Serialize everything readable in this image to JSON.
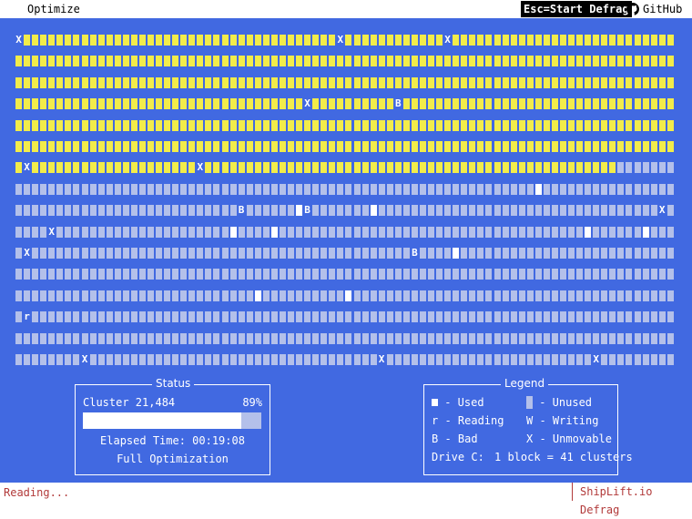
{
  "menu": {
    "optimize": "Optimize"
  },
  "toolbar": {
    "esc_hint": "Esc=Start Defrag",
    "github_label": "GitHub"
  },
  "colors": {
    "background": "#4169e1",
    "used": "#f2ec4a",
    "bar_text": "#b23a3a"
  },
  "disk_map": {
    "rows": [
      "X                                      X            X                                                 ",
      "                                                                                                      ",
      "                                                                                                      ",
      "                                   X          B                                                       ",
      "                                                                                                  X   ",
      "                                                                                                      ",
      " X                    X                                                                     ..........",
      "...............................................................w......................................",
      "...........................B......wB.......w..................................X.........................w",
      "....X.....................w....w.....................................w......w...........................",
      ".X..............................................B....w.................................................",
      "..................................................................................r...................",
      ".............................w..........w..............................................................",
      ".r................................................................................X.............w.....",
      ".............................................................................................w.X.....",
      "........X...................................X.........................X..............................."
    ]
  },
  "status": {
    "title": "Status",
    "cluster": "Cluster 21,484",
    "percent": "89%",
    "progress": 0.89,
    "elapsed": "Elapsed Time: 00:19:08",
    "mode": "Full Optimization"
  },
  "legend": {
    "title": "Legend",
    "used": "- Used",
    "unused": "- Unused",
    "reading": "r - Reading",
    "writing": "W - Writing",
    "bad": "B - Bad",
    "unmovable": "X - Unmovable",
    "drive": "Drive C:",
    "block": "1 block = 41 clusters"
  },
  "statusbar": {
    "message": "Reading...",
    "brand": "ShipLift.io Defrag"
  }
}
